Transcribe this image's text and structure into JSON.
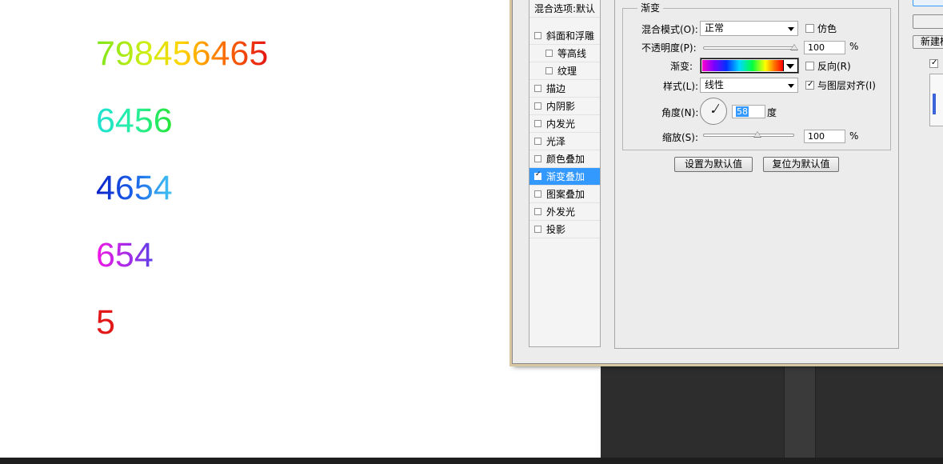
{
  "canvas": {
    "numbers": [
      "798456465",
      "6456",
      "4654",
      "654",
      "5"
    ]
  },
  "style_list": {
    "header": "混合选项:默认",
    "items": [
      {
        "label": "斜面和浮雕",
        "checked": false,
        "sub": false
      },
      {
        "label": "等高线",
        "checked": false,
        "sub": true
      },
      {
        "label": "纹理",
        "checked": false,
        "sub": true
      },
      {
        "label": "描边",
        "checked": false,
        "sub": false
      },
      {
        "label": "内阴影",
        "checked": false,
        "sub": false
      },
      {
        "label": "内发光",
        "checked": false,
        "sub": false
      },
      {
        "label": "光泽",
        "checked": false,
        "sub": false
      },
      {
        "label": "颜色叠加",
        "checked": false,
        "sub": false
      },
      {
        "label": "渐变叠加",
        "checked": true,
        "sub": false,
        "selected": true
      },
      {
        "label": "图案叠加",
        "checked": false,
        "sub": false
      },
      {
        "label": "外发光",
        "checked": false,
        "sub": false
      },
      {
        "label": "投影",
        "checked": false,
        "sub": false
      }
    ]
  },
  "gradient_overlay": {
    "group_title": "渐变",
    "blend_mode_label": "混合模式(O):",
    "blend_mode_value": "正常",
    "dither_label": "仿色",
    "opacity_label": "不透明度(P):",
    "opacity_value": "100",
    "opacity_unit": "%",
    "opacity_fraction": 1.0,
    "gradient_label": "渐变:",
    "reverse_label": "反向(R)",
    "style_label": "样式(L):",
    "style_value": "线性",
    "align_label": "与图层对齐(I)",
    "align_checked": true,
    "angle_label": "角度(N):",
    "angle_value": "58",
    "angle_unit": "度",
    "scale_label": "缩放(S):",
    "scale_value": "100",
    "scale_unit": "%",
    "scale_fraction": 0.6,
    "make_default_label": "设置为默认值",
    "reset_default_label": "复位为默认值"
  },
  "right_side": {
    "new_style_label": "新建样"
  },
  "colors": {
    "selection": "#3399ff",
    "dialog_bg": "#ececec",
    "canvas_bg": "#ffffff"
  }
}
